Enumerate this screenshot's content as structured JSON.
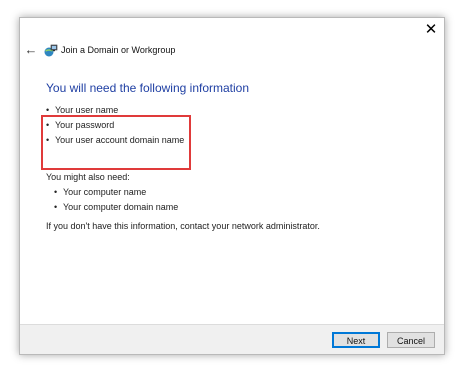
{
  "window": {
    "close_symbol": "✕",
    "back_symbol": "←",
    "title": "Join a Domain or Workgroup"
  },
  "content": {
    "heading": "You will need the following information",
    "required_items": [
      "Your user name",
      "Your password",
      "Your user account domain name"
    ],
    "also_label": "You might also need:",
    "optional_items": [
      "Your computer name",
      "Your computer domain name"
    ],
    "note": "If you don't have this information, contact your network administrator."
  },
  "footer": {
    "next_label": "Next",
    "cancel_label": "Cancel"
  },
  "colors": {
    "heading": "#1f3fa3",
    "highlight_border": "#e03a3a",
    "accent": "#0078d7"
  },
  "icons": {
    "back": "back-arrow-icon",
    "close": "close-icon",
    "wizard": "network-globe-icon"
  }
}
